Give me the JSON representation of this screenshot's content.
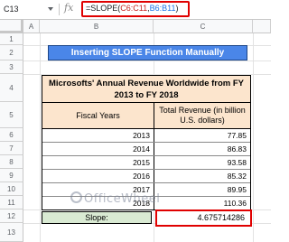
{
  "formula_bar": {
    "cell_ref": "C13",
    "fx_symbol": "fx",
    "formula_prefix": "=SLOPE(",
    "formula_arg1": "C6:C11",
    "formula_comma": ",",
    "formula_arg2": "B6:B11",
    "formula_suffix": ")"
  },
  "columns": [
    "A",
    "B",
    "C"
  ],
  "rows": [
    "1",
    "2",
    "3",
    "4",
    "5",
    "6",
    "7",
    "8",
    "9",
    "10",
    "11",
    "12",
    "13"
  ],
  "title": "Inserting SLOPE Function Manually",
  "table": {
    "caption": "Microsofts' Annual Revenue Worldwide from FY 2013 to FY 2018",
    "headers": [
      "Fiscal Years",
      "Total Revenue (in billion U.S. dollars)"
    ],
    "rows": [
      {
        "year": "2013",
        "revenue": "77.85"
      },
      {
        "year": "2014",
        "revenue": "86.83"
      },
      {
        "year": "2015",
        "revenue": "93.58"
      },
      {
        "year": "2016",
        "revenue": "85.32"
      },
      {
        "year": "2017",
        "revenue": "89.95"
      },
      {
        "year": "2018",
        "revenue": "110.36"
      }
    ]
  },
  "slope": {
    "label": "Slope:",
    "value": "4.675714286"
  },
  "watermark": {
    "text": "OfficeWheel"
  },
  "colors": {
    "title_bg": "#4a86e8",
    "table_header_bg": "#fce5cd",
    "slope_label_bg": "#d9ead3",
    "highlight_border": "#e00000"
  }
}
